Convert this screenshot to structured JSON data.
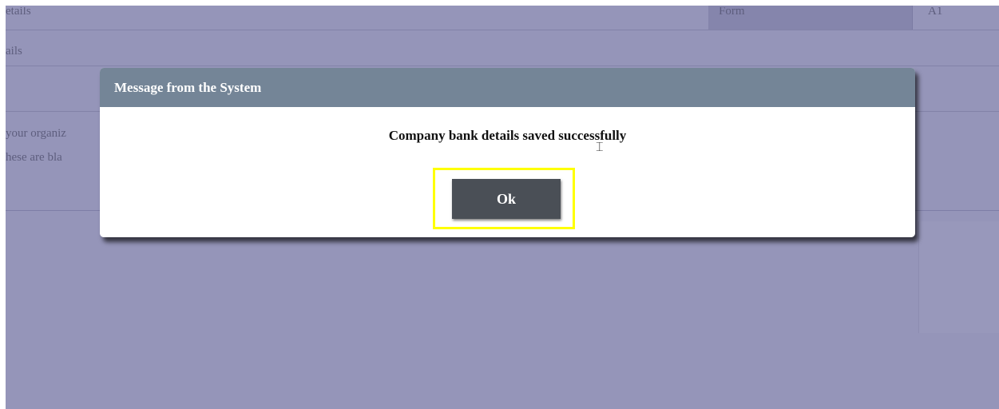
{
  "background": {
    "row1_left_text": "etails",
    "row2_left_text": "ails",
    "row4_line1_text": "your organiz",
    "row4_line2_text": "hese are bla",
    "form_label": "Form",
    "form_value": "A1"
  },
  "dialog": {
    "title": "Message from the System",
    "message": "Company bank details saved successfully",
    "ok_label": "Ok"
  },
  "colors": {
    "overlay": "#9595b9",
    "header": "#748597",
    "button": "#4a4f56",
    "highlight": "#ffff00"
  }
}
